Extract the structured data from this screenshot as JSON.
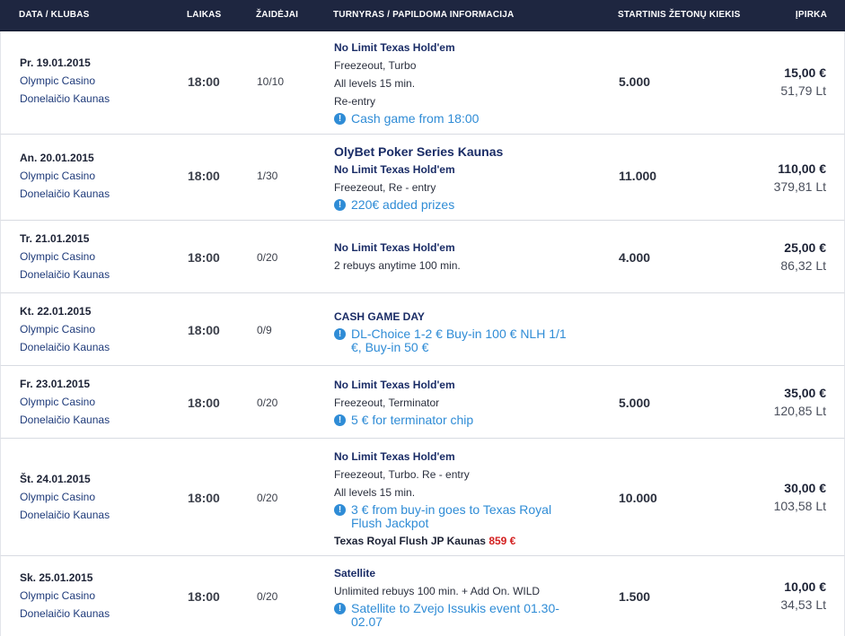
{
  "header": {
    "date_club": "DATA / KLUBAS",
    "time": "LAIKAS",
    "players": "ŽAIDĖJAI",
    "tournament": "TURNYRAS / PAPILDOMA INFORMACIJA",
    "chips": "STARTINIS ŽETONŲ KIEKIS",
    "buyin": "ĮPIRKA"
  },
  "rows": [
    {
      "date": "Pr. 19.01.2015",
      "club": "Olympic Casino",
      "venue": "Donelaičio Kaunas",
      "time": "18:00",
      "players": "10/10",
      "name": "No Limit Texas Hold'em",
      "line1": "Freezeout, Turbo",
      "line2": "All levels 15 min.",
      "line3": "Re-entry",
      "info": "Cash game from 18:00",
      "chips": "5.000",
      "eur": "15,00 €",
      "lt": "51,79 Lt"
    },
    {
      "date": "An. 20.01.2015",
      "club": "Olympic Casino",
      "venue": "Donelaičio Kaunas",
      "time": "18:00",
      "players": "1/30",
      "series": "OlyBet Poker Series Kaunas",
      "name": "No Limit Texas Hold'em",
      "line1": "Freezeout, Re - entry",
      "info": "220€ added prizes",
      "chips": "11.000",
      "eur": "110,00 €",
      "lt": "379,81 Lt"
    },
    {
      "date": "Tr. 21.01.2015",
      "club": "Olympic Casino",
      "venue": "Donelaičio Kaunas",
      "time": "18:00",
      "players": "0/20",
      "name": "No Limit Texas Hold'em",
      "line1": "2 rebuys anytime 100 min.",
      "chips": "4.000",
      "eur": "25,00 €",
      "lt": "86,32 Lt"
    },
    {
      "date": "Kt. 22.01.2015",
      "club": "Olympic Casino",
      "venue": "Donelaičio Kaunas",
      "time": "18:00",
      "players": "0/9",
      "name": "CASH GAME DAY",
      "info": "DL-Choice 1-2 € Buy-in 100 € NLH 1/1 €, Buy-in 50 €"
    },
    {
      "date": "Fr. 23.01.2015",
      "club": "Olympic Casino",
      "venue": "Donelaičio Kaunas",
      "time": "18:00",
      "players": "0/20",
      "name": "No Limit Texas Hold'em",
      "line1": "Freezeout, Terminator",
      "info": "5 € for terminator chip",
      "chips": "5.000",
      "eur": "35,00 €",
      "lt": "120,85 Lt"
    },
    {
      "date": "Št. 24.01.2015",
      "club": "Olympic Casino",
      "venue": "Donelaičio Kaunas",
      "time": "18:00",
      "players": "0/20",
      "name": "No Limit Texas Hold'em",
      "line1": "Freezeout, Turbo. Re - entry",
      "line2": "All levels 15 min.",
      "info": "3 € from buy-in goes to Texas Royal Flush Jackpot",
      "jackpot_label": "Texas Royal Flush JP Kaunas",
      "jackpot_amount": "859 €",
      "chips": "10.000",
      "eur": "30,00 €",
      "lt": "103,58 Lt"
    },
    {
      "date": "Sk. 25.01.2015",
      "club": "Olympic Casino",
      "venue": "Donelaičio Kaunas",
      "time": "18:00",
      "players": "0/20",
      "name": "Satellite",
      "line1": "Unlimited rebuys 100 min. + Add On. WILD",
      "info": "Satellite to Zvejo Issukis event 01.30-02.07",
      "chips": "1.500",
      "eur": "10,00 €",
      "lt": "34,53 Lt"
    }
  ],
  "colors": {
    "header_bg": "#1e2640",
    "info": "#2f8cd6",
    "jackpot": "#d32020"
  },
  "icons": {
    "info": "info-icon"
  }
}
